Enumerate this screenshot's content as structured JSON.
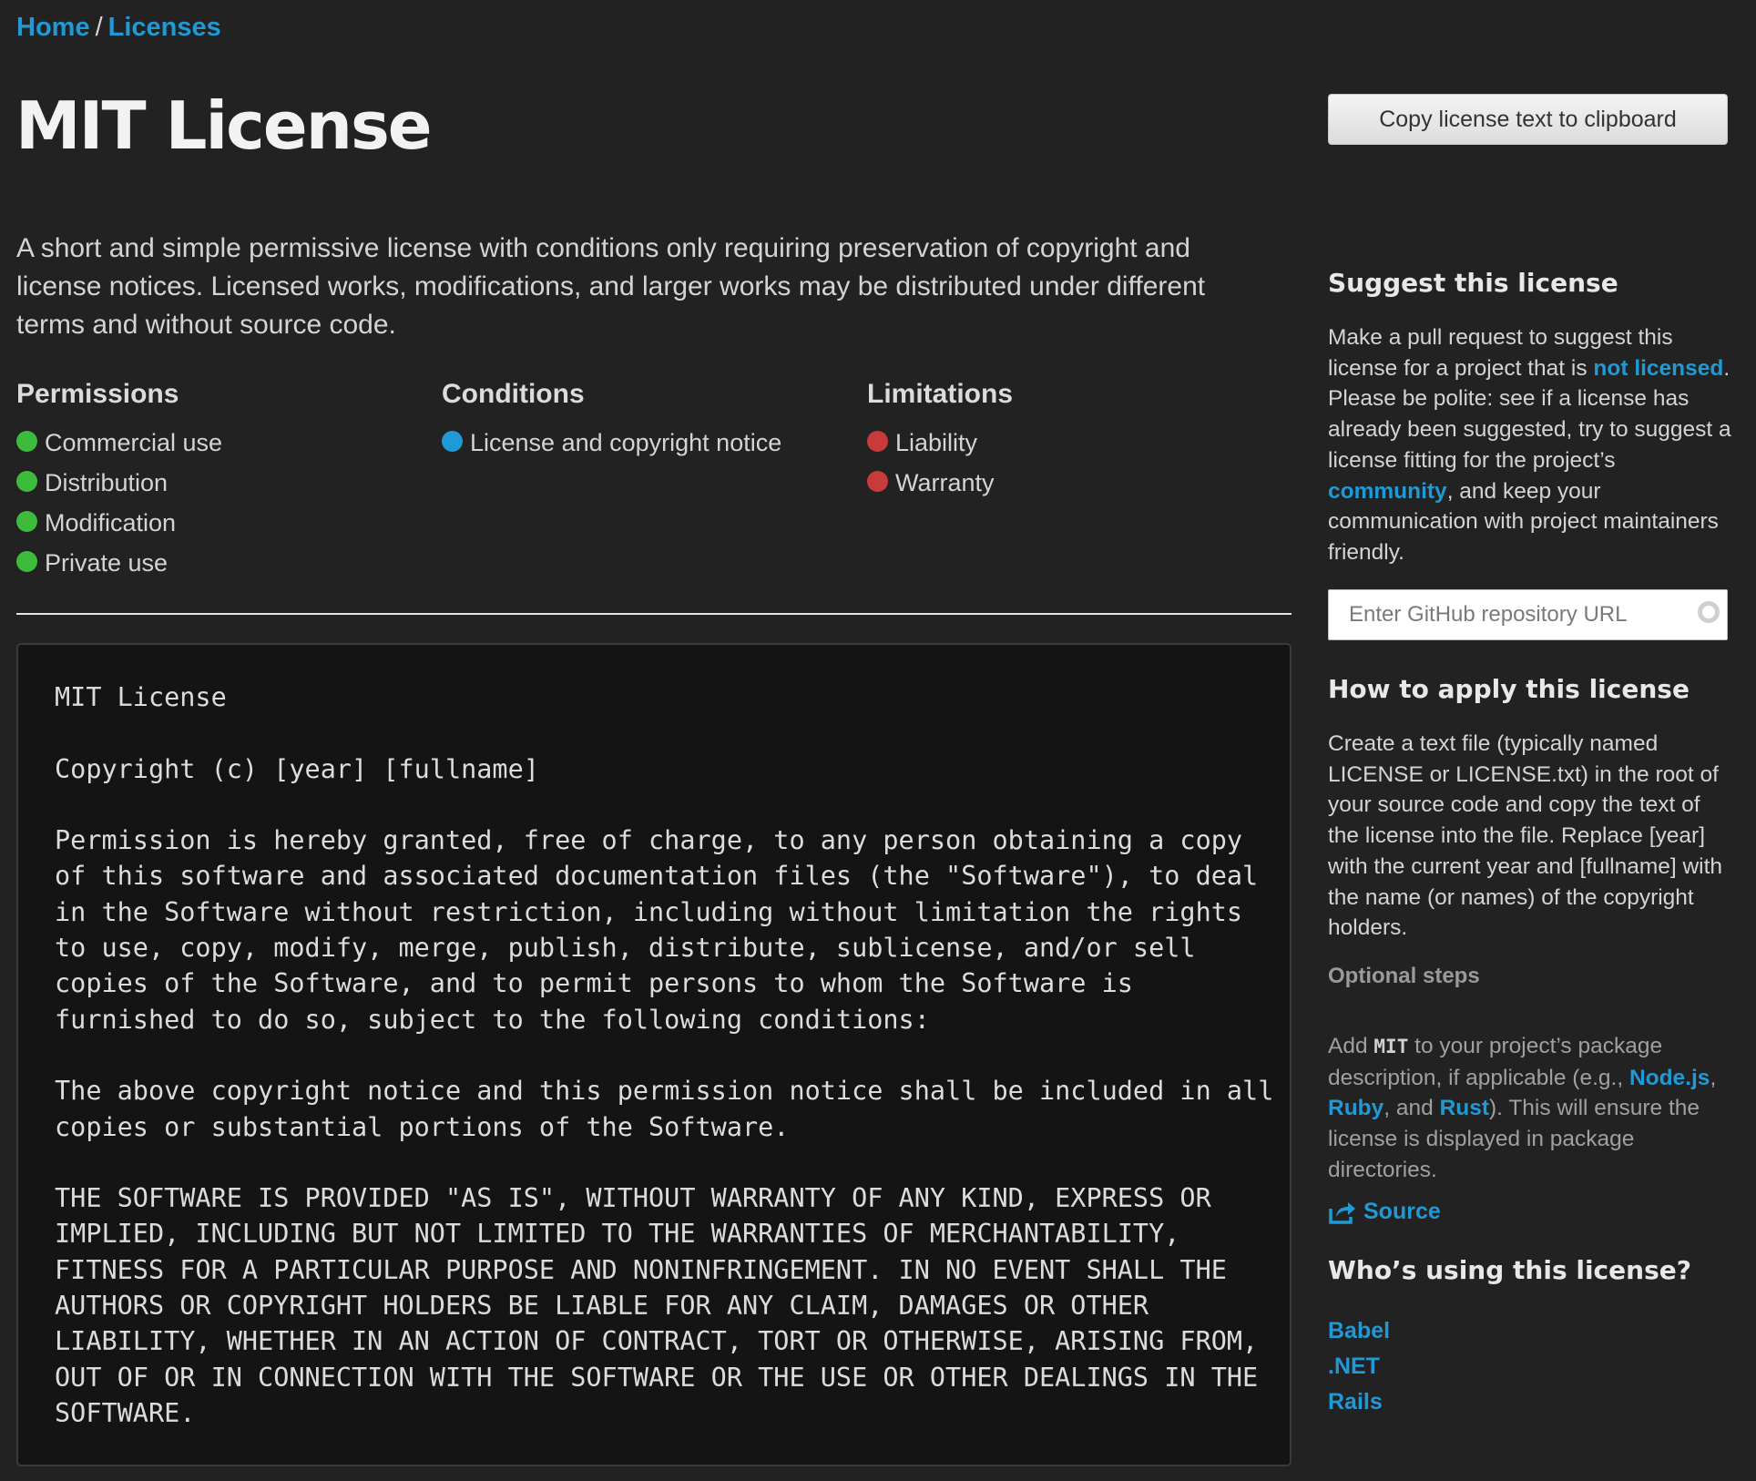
{
  "breadcrumb": {
    "home": "Home",
    "separator": "/",
    "current": "Licenses"
  },
  "page_title": "MIT License",
  "copy_button_label": "Copy license text to clipboard",
  "description": "A short and simple permissive license with conditions only requiring preservation of copyright and license notices. Licensed works, modifications, and larger works may be distributed under different terms and without source code.",
  "rules": {
    "permissions": {
      "title": "Permissions",
      "color": "#3dbb3d",
      "items": [
        "Commercial use",
        "Distribution",
        "Modification",
        "Private use"
      ]
    },
    "conditions": {
      "title": "Conditions",
      "color": "#1f9ad6",
      "items": [
        "License and copyright notice"
      ]
    },
    "limitations": {
      "title": "Limitations",
      "color": "#c93b3b",
      "items": [
        "Liability",
        "Warranty"
      ]
    }
  },
  "license_text": {
    "title": "MIT License",
    "copyright": "Copyright (c) [year] [fullname]",
    "permission": "Permission is hereby granted, free of charge, to any person obtaining a copy\nof this software and associated documentation files (the \"Software\"), to deal\nin the Software without restriction, including without limitation the rights\nto use, copy, modify, merge, publish, distribute, sublicense, and/or sell\ncopies of the Software, and to permit persons to whom the Software is\nfurnished to do so, subject to the following conditions:",
    "notice": "The above copyright notice and this permission notice shall be included in all\ncopies or substantial portions of the Software.",
    "warranty": "THE SOFTWARE IS PROVIDED \"AS IS\", WITHOUT WARRANTY OF ANY KIND, EXPRESS OR\nIMPLIED, INCLUDING BUT NOT LIMITED TO THE WARRANTIES OF MERCHANTABILITY,\nFITNESS FOR A PARTICULAR PURPOSE AND NONINFRINGEMENT. IN NO EVENT SHALL THE\nAUTHORS OR COPYRIGHT HOLDERS BE LIABLE FOR ANY CLAIM, DAMAGES OR OTHER\nLIABILITY, WHETHER IN AN ACTION OF CONTRACT, TORT OR OTHERWISE, ARISING FROM,\nOUT OF OR IN CONNECTION WITH THE SOFTWARE OR THE USE OR OTHER DEALINGS IN THE\nSOFTWARE."
  },
  "sidebar": {
    "suggest": {
      "title": "Suggest this license",
      "text_1": "Make a pull request to suggest this license for a project that is ",
      "link_not_licensed": "not licensed",
      "text_2": ". Please be polite: see if a license has already been suggested, try to suggest a license fitting for the project’s ",
      "link_community": "community",
      "text_3": ", and keep your communication with project maintainers friendly."
    },
    "repo_input": {
      "placeholder": "Enter GitHub repository URL",
      "value": ""
    },
    "apply": {
      "title": "How to apply this license",
      "text": "Create a text file (typically named LICENSE or LICENSE.txt) in the root of your source code and copy the text of the license into the file. Replace [year] with the current year and [fullname] with the name (or names) of the copyright holders."
    },
    "optional": {
      "title": "Optional steps",
      "text_1": "Add ",
      "code": "MIT",
      "text_2": " to your project’s package description, if applicable (e.g., ",
      "link_node": "Node.js",
      "text_3": ", ",
      "link_ruby": "Ruby",
      "text_4": ", and ",
      "link_rust": "Rust",
      "text_5": "). This will ensure the license is displayed in package directories."
    },
    "source_link": "Source",
    "source_icon": "share-icon",
    "users": {
      "title": "Who’s using this license?",
      "items": [
        "Babel",
        ".NET",
        "Rails"
      ]
    }
  },
  "colors": {
    "background": "#222222",
    "link": "#1f9ad6",
    "code_background": "#141414"
  }
}
